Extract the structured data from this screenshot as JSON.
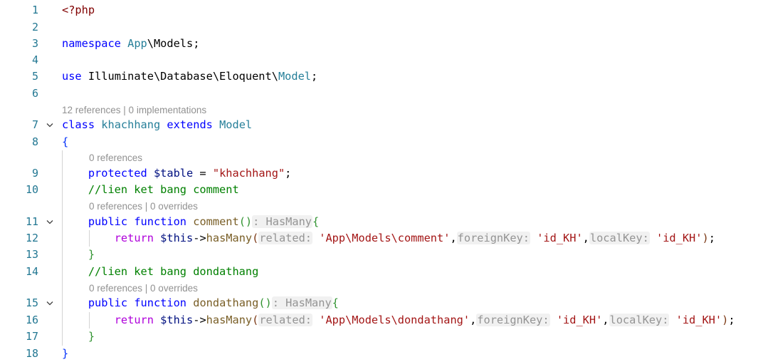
{
  "line_numbers": [
    "1",
    "2",
    "3",
    "4",
    "5",
    "6",
    "7",
    "8",
    "9",
    "10",
    "11",
    "12",
    "13",
    "14",
    "15",
    "16",
    "17",
    "18"
  ],
  "codelens": {
    "class": "12 references | 0 implementations",
    "table": "0 references",
    "comment_fn": "0 references | 0 overrides",
    "dondathang_fn": "0 references | 0 overrides"
  },
  "code": {
    "php_open": "<?php",
    "namespace_kw": "namespace",
    "namespace_a": "App",
    "namespace_b": "\\Models;",
    "use_kw": "use",
    "use_path": "Illuminate\\Database\\Eloquent\\",
    "use_class": "Model",
    "class_kw": "class",
    "class_name": "khachhang",
    "extends_kw": "extends",
    "parent_class": "Model",
    "brace_open": "{",
    "brace_close": "}",
    "protected_kw": "protected",
    "table_var": "$table",
    "table_value": "\"khachhang\"",
    "comment1": "//lien ket bang comment",
    "comment2": "//lien ket bang dondathang",
    "public_kw": "public",
    "function_kw": "function",
    "fn1_name": "comment",
    "fn2_name": "dondathang",
    "return_hint": ": HasMany",
    "return_kw": "return",
    "this_var": "$this",
    "arrow": "->",
    "has_many": "hasMany",
    "hint_related": "related:",
    "hint_foreign": "foreignKey:",
    "hint_local": "localKey:",
    "model_comment": "'App\\Models\\comment'",
    "model_dondathang": "'App\\Models\\dondathang'",
    "key_id": "'id_KH'"
  },
  "colors": {
    "keyword": "#0000ff",
    "string": "#a31515",
    "comment": "#008000",
    "type": "#267f99",
    "line_number": "#237893"
  },
  "icons": [
    "fold-chevron-icon"
  ]
}
